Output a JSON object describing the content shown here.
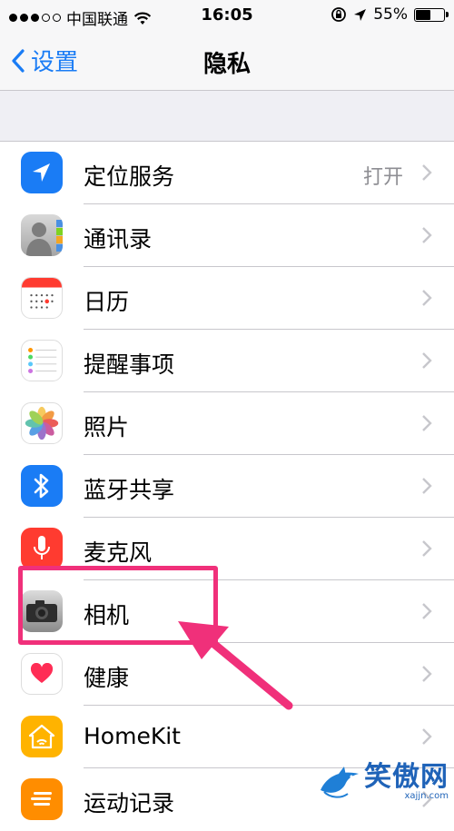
{
  "status_bar": {
    "carrier": "中国联通",
    "time": "16:05",
    "battery_text": "55%",
    "battery_level": 0.55
  },
  "nav": {
    "back_label": "设置",
    "title": "隐私"
  },
  "rows": [
    {
      "label": "定位服务",
      "value": "打开",
      "icon": "location-arrow-icon",
      "color": "#1a7cf5"
    },
    {
      "label": "通讯录",
      "value": "",
      "icon": "contacts-icon",
      "color": "#8e8e93"
    },
    {
      "label": "日历",
      "value": "",
      "icon": "calendar-icon",
      "color": "#ffffff"
    },
    {
      "label": "提醒事项",
      "value": "",
      "icon": "reminders-icon",
      "color": "#ffffff"
    },
    {
      "label": "照片",
      "value": "",
      "icon": "photos-icon",
      "color": "#ffffff"
    },
    {
      "label": "蓝牙共享",
      "value": "",
      "icon": "bluetooth-icon",
      "color": "#1a7cf5"
    },
    {
      "label": "麦克风",
      "value": "",
      "icon": "microphone-icon",
      "color": "#ff3b30"
    },
    {
      "label": "相机",
      "value": "",
      "icon": "camera-icon",
      "color": "#8e8e93"
    },
    {
      "label": "健康",
      "value": "",
      "icon": "health-heart-icon",
      "color": "#ffffff"
    },
    {
      "label": "HomeKit",
      "value": "",
      "icon": "homekit-icon",
      "color": "#ffb300"
    },
    {
      "label": "运动记录",
      "value": "",
      "icon": "motion-activity-icon",
      "color": "#ff8d00"
    }
  ],
  "annotation": {
    "highlight_color": "#f0307a",
    "highlighted_row": "相机"
  },
  "watermark": {
    "text": "笑傲网",
    "url": "xajjn.com"
  }
}
